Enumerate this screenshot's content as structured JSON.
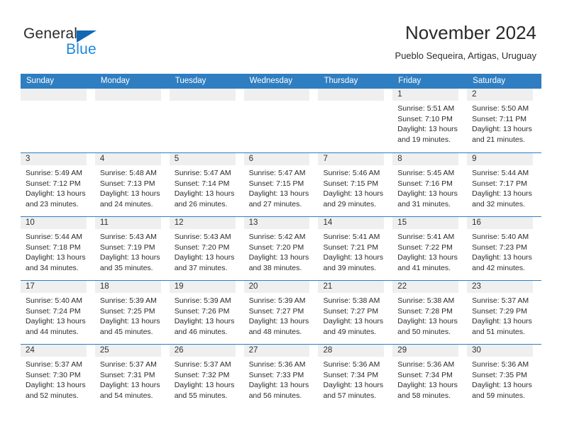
{
  "logo": {
    "word_one": "General",
    "word_two": "Blue",
    "triangle_icon": "blue-triangle-icon",
    "brand_color": "#1f87de",
    "triangle_color": "#1268b3"
  },
  "header": {
    "title": "November 2024",
    "subtitle": "Pueblo Sequeira, Artigas, Uruguay"
  },
  "calendar": {
    "accent_color": "#2f7ec1",
    "band_color": "#efefef",
    "weekdays": [
      "Sunday",
      "Monday",
      "Tuesday",
      "Wednesday",
      "Thursday",
      "Friday",
      "Saturday"
    ],
    "weeks": [
      [
        {
          "day": "",
          "lines": []
        },
        {
          "day": "",
          "lines": []
        },
        {
          "day": "",
          "lines": []
        },
        {
          "day": "",
          "lines": []
        },
        {
          "day": "",
          "lines": []
        },
        {
          "day": "1",
          "lines": [
            "Sunrise: 5:51 AM",
            "Sunset: 7:10 PM",
            "Daylight: 13 hours",
            "and 19 minutes."
          ]
        },
        {
          "day": "2",
          "lines": [
            "Sunrise: 5:50 AM",
            "Sunset: 7:11 PM",
            "Daylight: 13 hours",
            "and 21 minutes."
          ]
        }
      ],
      [
        {
          "day": "3",
          "lines": [
            "Sunrise: 5:49 AM",
            "Sunset: 7:12 PM",
            "Daylight: 13 hours",
            "and 23 minutes."
          ]
        },
        {
          "day": "4",
          "lines": [
            "Sunrise: 5:48 AM",
            "Sunset: 7:13 PM",
            "Daylight: 13 hours",
            "and 24 minutes."
          ]
        },
        {
          "day": "5",
          "lines": [
            "Sunrise: 5:47 AM",
            "Sunset: 7:14 PM",
            "Daylight: 13 hours",
            "and 26 minutes."
          ]
        },
        {
          "day": "6",
          "lines": [
            "Sunrise: 5:47 AM",
            "Sunset: 7:15 PM",
            "Daylight: 13 hours",
            "and 27 minutes."
          ]
        },
        {
          "day": "7",
          "lines": [
            "Sunrise: 5:46 AM",
            "Sunset: 7:15 PM",
            "Daylight: 13 hours",
            "and 29 minutes."
          ]
        },
        {
          "day": "8",
          "lines": [
            "Sunrise: 5:45 AM",
            "Sunset: 7:16 PM",
            "Daylight: 13 hours",
            "and 31 minutes."
          ]
        },
        {
          "day": "9",
          "lines": [
            "Sunrise: 5:44 AM",
            "Sunset: 7:17 PM",
            "Daylight: 13 hours",
            "and 32 minutes."
          ]
        }
      ],
      [
        {
          "day": "10",
          "lines": [
            "Sunrise: 5:44 AM",
            "Sunset: 7:18 PM",
            "Daylight: 13 hours",
            "and 34 minutes."
          ]
        },
        {
          "day": "11",
          "lines": [
            "Sunrise: 5:43 AM",
            "Sunset: 7:19 PM",
            "Daylight: 13 hours",
            "and 35 minutes."
          ]
        },
        {
          "day": "12",
          "lines": [
            "Sunrise: 5:43 AM",
            "Sunset: 7:20 PM",
            "Daylight: 13 hours",
            "and 37 minutes."
          ]
        },
        {
          "day": "13",
          "lines": [
            "Sunrise: 5:42 AM",
            "Sunset: 7:20 PM",
            "Daylight: 13 hours",
            "and 38 minutes."
          ]
        },
        {
          "day": "14",
          "lines": [
            "Sunrise: 5:41 AM",
            "Sunset: 7:21 PM",
            "Daylight: 13 hours",
            "and 39 minutes."
          ]
        },
        {
          "day": "15",
          "lines": [
            "Sunrise: 5:41 AM",
            "Sunset: 7:22 PM",
            "Daylight: 13 hours",
            "and 41 minutes."
          ]
        },
        {
          "day": "16",
          "lines": [
            "Sunrise: 5:40 AM",
            "Sunset: 7:23 PM",
            "Daylight: 13 hours",
            "and 42 minutes."
          ]
        }
      ],
      [
        {
          "day": "17",
          "lines": [
            "Sunrise: 5:40 AM",
            "Sunset: 7:24 PM",
            "Daylight: 13 hours",
            "and 44 minutes."
          ]
        },
        {
          "day": "18",
          "lines": [
            "Sunrise: 5:39 AM",
            "Sunset: 7:25 PM",
            "Daylight: 13 hours",
            "and 45 minutes."
          ]
        },
        {
          "day": "19",
          "lines": [
            "Sunrise: 5:39 AM",
            "Sunset: 7:26 PM",
            "Daylight: 13 hours",
            "and 46 minutes."
          ]
        },
        {
          "day": "20",
          "lines": [
            "Sunrise: 5:39 AM",
            "Sunset: 7:27 PM",
            "Daylight: 13 hours",
            "and 48 minutes."
          ]
        },
        {
          "day": "21",
          "lines": [
            "Sunrise: 5:38 AM",
            "Sunset: 7:27 PM",
            "Daylight: 13 hours",
            "and 49 minutes."
          ]
        },
        {
          "day": "22",
          "lines": [
            "Sunrise: 5:38 AM",
            "Sunset: 7:28 PM",
            "Daylight: 13 hours",
            "and 50 minutes."
          ]
        },
        {
          "day": "23",
          "lines": [
            "Sunrise: 5:37 AM",
            "Sunset: 7:29 PM",
            "Daylight: 13 hours",
            "and 51 minutes."
          ]
        }
      ],
      [
        {
          "day": "24",
          "lines": [
            "Sunrise: 5:37 AM",
            "Sunset: 7:30 PM",
            "Daylight: 13 hours",
            "and 52 minutes."
          ]
        },
        {
          "day": "25",
          "lines": [
            "Sunrise: 5:37 AM",
            "Sunset: 7:31 PM",
            "Daylight: 13 hours",
            "and 54 minutes."
          ]
        },
        {
          "day": "26",
          "lines": [
            "Sunrise: 5:37 AM",
            "Sunset: 7:32 PM",
            "Daylight: 13 hours",
            "and 55 minutes."
          ]
        },
        {
          "day": "27",
          "lines": [
            "Sunrise: 5:36 AM",
            "Sunset: 7:33 PM",
            "Daylight: 13 hours",
            "and 56 minutes."
          ]
        },
        {
          "day": "28",
          "lines": [
            "Sunrise: 5:36 AM",
            "Sunset: 7:34 PM",
            "Daylight: 13 hours",
            "and 57 minutes."
          ]
        },
        {
          "day": "29",
          "lines": [
            "Sunrise: 5:36 AM",
            "Sunset: 7:34 PM",
            "Daylight: 13 hours",
            "and 58 minutes."
          ]
        },
        {
          "day": "30",
          "lines": [
            "Sunrise: 5:36 AM",
            "Sunset: 7:35 PM",
            "Daylight: 13 hours",
            "and 59 minutes."
          ]
        }
      ]
    ]
  }
}
